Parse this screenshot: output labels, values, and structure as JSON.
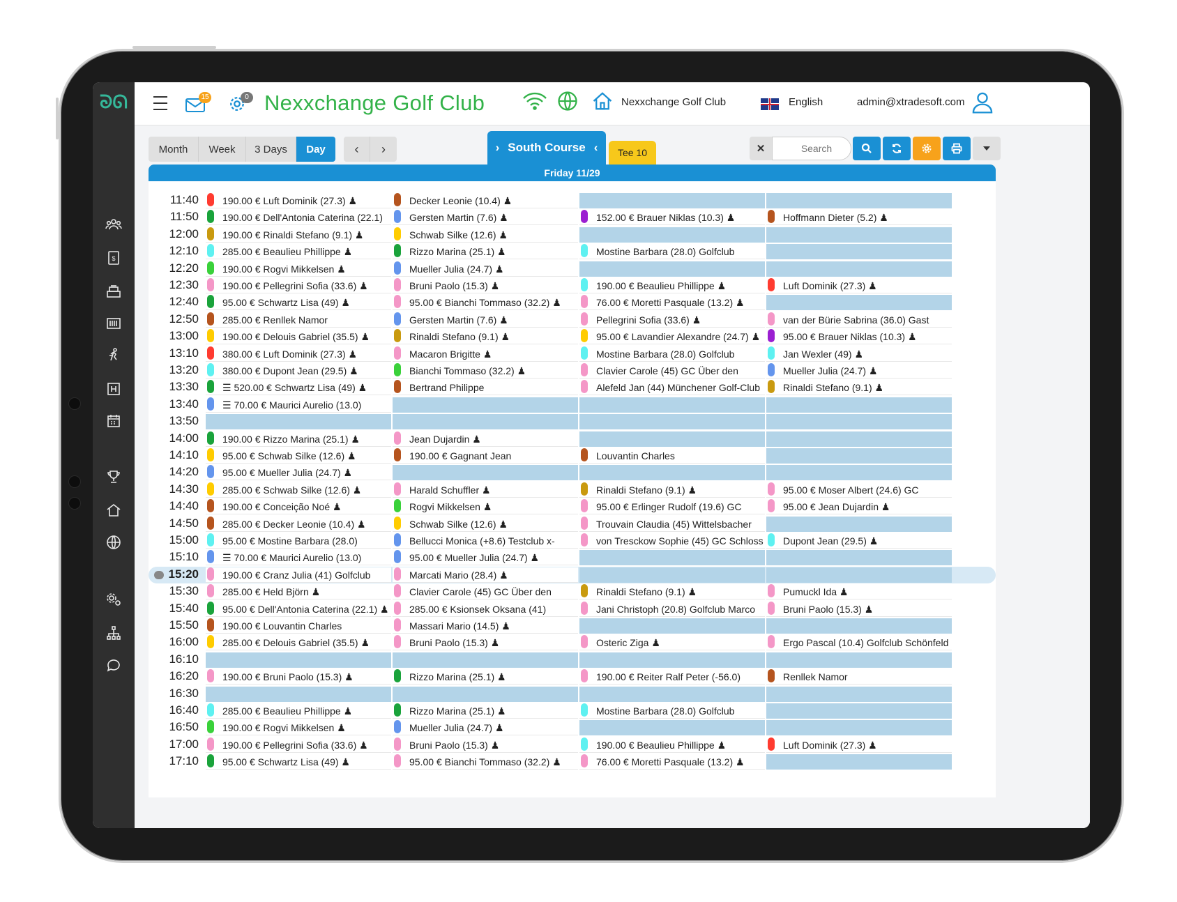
{
  "app": {
    "title": "Nexxchange Golf Club",
    "mail_count": "15",
    "settings_count": "0",
    "club": "Nexxchange Golf Club",
    "language": "English",
    "user": "admin@xtradesoft.com"
  },
  "sidebar": {
    "icons": [
      "group-icon",
      "invoice-icon",
      "register-icon",
      "barcode-icon",
      "activity-icon",
      "hotel-icon",
      "calendar-icon",
      "trophy-icon",
      "home-icon",
      "globe-icon",
      "settings-icon",
      "org-chart-icon",
      "chat-icon"
    ]
  },
  "toolbar": {
    "views": [
      "Month",
      "Week",
      "3 Days",
      "Day"
    ],
    "active_view": "Day",
    "prev": "‹",
    "next": "›",
    "course": "South Course",
    "tee": "Tee 10",
    "clear": "✕",
    "search_placeholder": "Search",
    "date": "Friday 11/29"
  },
  "colors": {
    "accent": "#1a90d4",
    "brand": "#33b249",
    "empty_slot": "#b3d4e8",
    "orange": "#f7a21b"
  },
  "tee_sheet": {
    "current_time": "15:20",
    "rows": [
      {
        "time": "11:40",
        "slots": [
          {
            "c": "#ff3b30",
            "t": "190.00 € Luft Dominik (27.3) ♟"
          },
          {
            "c": "#b5541e",
            "t": "Decker Leonie (10.4) ♟"
          },
          null,
          null
        ]
      },
      {
        "time": "11:50",
        "slots": [
          {
            "c": "#1aa33b",
            "t": "190.00 € Dell'Antonia Caterina (22.1)"
          },
          {
            "c": "#6495ed",
            "t": "Gersten Martin (7.6) ♟"
          },
          {
            "c": "#9b1fd1",
            "t": "152.00 € Brauer Niklas (10.3) ♟"
          },
          {
            "c": "#b5541e",
            "t": "Hoffmann Dieter (5.2) ♟"
          }
        ]
      },
      {
        "time": "12:00",
        "slots": [
          {
            "c": "#c99a0f",
            "t": "190.00 € Rinaldi Stefano (9.1) ♟"
          },
          {
            "c": "#ffcc00",
            "t": "Schwab Silke (12.6) ♟"
          },
          null,
          null
        ]
      },
      {
        "time": "12:10",
        "slots": [
          {
            "c": "#5ef1f1",
            "t": "285.00 € Beaulieu Phillippe ♟"
          },
          {
            "c": "#1aa33b",
            "t": "Rizzo Marina (25.1) ♟"
          },
          {
            "c": "#5ef1f1",
            "t": "Mostine Barbara (28.0) Golfclub"
          },
          null
        ]
      },
      {
        "time": "12:20",
        "slots": [
          {
            "c": "#3ad13a",
            "t": "190.00 € Rogvi Mikkelsen ♟"
          },
          {
            "c": "#6495ed",
            "t": "Mueller Julia (24.7) ♟"
          },
          null,
          null
        ]
      },
      {
        "time": "12:30",
        "slots": [
          {
            "c": "#f497c7",
            "t": "190.00 € Pellegrini Sofia (33.6) ♟"
          },
          {
            "c": "#f497c7",
            "t": "Bruni Paolo (15.3) ♟"
          },
          {
            "c": "#5ef1f1",
            "t": "190.00 € Beaulieu Phillippe ♟"
          },
          {
            "c": "#ff3b30",
            "t": "Luft Dominik (27.3) ♟"
          }
        ]
      },
      {
        "time": "12:40",
        "slots": [
          {
            "c": "#1aa33b",
            "t": "95.00 € Schwartz Lisa (49) ♟"
          },
          {
            "c": "#f497c7",
            "t": "95.00 € Bianchi Tommaso (32.2) ♟"
          },
          {
            "c": "#f497c7",
            "t": "76.00 € Moretti Pasquale (13.2) ♟"
          },
          null
        ]
      },
      {
        "time": "12:50",
        "slots": [
          {
            "c": "#b5541e",
            "t": "285.00 € Renllek Namor"
          },
          {
            "c": "#6495ed",
            "t": "Gersten Martin (7.6) ♟"
          },
          {
            "c": "#f497c7",
            "t": "Pellegrini Sofia (33.6) ♟"
          },
          {
            "c": "#f497c7",
            "t": "van der Bürie Sabrina (36.0) Gast"
          }
        ]
      },
      {
        "time": "13:00",
        "slots": [
          {
            "c": "#ffcc00",
            "t": "190.00 € Delouis Gabriel (35.5) ♟"
          },
          {
            "c": "#c99a0f",
            "t": "Rinaldi Stefano (9.1) ♟"
          },
          {
            "c": "#ffcc00",
            "t": "95.00 € Lavandier Alexandre (24.7) ♟"
          },
          {
            "c": "#9b1fd1",
            "t": "95.00 € Brauer Niklas (10.3) ♟"
          }
        ]
      },
      {
        "time": "13:10",
        "slots": [
          {
            "c": "#ff3b30",
            "t": "380.00 € Luft Dominik (27.3) ♟"
          },
          {
            "c": "#f497c7",
            "t": "Macaron Brigitte ♟"
          },
          {
            "c": "#5ef1f1",
            "t": "Mostine Barbara (28.0) Golfclub"
          },
          {
            "c": "#5ef1f1",
            "t": "Jan Wexler (49) ♟"
          }
        ]
      },
      {
        "time": "13:20",
        "slots": [
          {
            "c": "#5ef1f1",
            "t": "380.00 € Dupont Jean (29.5) ♟"
          },
          {
            "c": "#3ad13a",
            "t": "Bianchi Tommaso (32.2) ♟"
          },
          {
            "c": "#f497c7",
            "t": "Clavier Carole (45) GC Über den"
          },
          {
            "c": "#6495ed",
            "t": "Mueller Julia (24.7) ♟"
          }
        ]
      },
      {
        "time": "13:30",
        "slots": [
          {
            "c": "#1aa33b",
            "t": "☰ 520.00 € Schwartz Lisa (49) ♟"
          },
          {
            "c": "#b5541e",
            "t": "Bertrand Philippe"
          },
          {
            "c": "#f497c7",
            "t": "Alefeld Jan (44) Münchener Golf-Club"
          },
          {
            "c": "#c99a0f",
            "t": "Rinaldi Stefano (9.1) ♟"
          }
        ]
      },
      {
        "time": "13:40",
        "slots": [
          {
            "c": "#6495ed",
            "t": "☰ 70.00 € Maurici Aurelio (13.0)"
          },
          null,
          null,
          null
        ]
      },
      {
        "time": "13:50",
        "slots": [
          null,
          null,
          null,
          null
        ]
      },
      {
        "time": "14:00",
        "slots": [
          {
            "c": "#1aa33b",
            "t": "190.00 € Rizzo Marina (25.1) ♟"
          },
          {
            "c": "#f497c7",
            "t": "Jean Dujardin ♟"
          },
          null,
          null
        ]
      },
      {
        "time": "14:10",
        "slots": [
          {
            "c": "#ffcc00",
            "t": "95.00 € Schwab Silke (12.6) ♟"
          },
          {
            "c": "#b5541e",
            "t": "190.00 € Gagnant Jean"
          },
          {
            "c": "#b5541e",
            "t": "Louvantin Charles"
          },
          null
        ]
      },
      {
        "time": "14:20",
        "slots": [
          {
            "c": "#6495ed",
            "t": "95.00 € Mueller Julia (24.7) ♟"
          },
          null,
          null,
          null
        ]
      },
      {
        "time": "14:30",
        "slots": [
          {
            "c": "#ffcc00",
            "t": "285.00 € Schwab Silke (12.6) ♟"
          },
          {
            "c": "#f497c7",
            "t": "Harald Schuffler ♟"
          },
          {
            "c": "#c99a0f",
            "t": "Rinaldi Stefano (9.1) ♟"
          },
          {
            "c": "#f497c7",
            "t": "95.00 € Moser Albert (24.6) GC"
          }
        ]
      },
      {
        "time": "14:40",
        "slots": [
          {
            "c": "#b5541e",
            "t": "190.00 € Conceição Noé ♟"
          },
          {
            "c": "#3ad13a",
            "t": "Rogvi Mikkelsen ♟"
          },
          {
            "c": "#f497c7",
            "t": "95.00 € Erlinger Rudolf (19.6) GC"
          },
          {
            "c": "#f497c7",
            "t": "95.00 € Jean Dujardin ♟"
          }
        ]
      },
      {
        "time": "14:50",
        "slots": [
          {
            "c": "#b5541e",
            "t": "285.00 € Decker Leonie (10.4) ♟"
          },
          {
            "c": "#ffcc00",
            "t": "Schwab Silke (12.6) ♟"
          },
          {
            "c": "#f497c7",
            "t": "Trouvain Claudia (45) Wittelsbacher"
          },
          null
        ]
      },
      {
        "time": "15:00",
        "slots": [
          {
            "c": "#5ef1f1",
            "t": "95.00 € Mostine Barbara (28.0)"
          },
          {
            "c": "#6495ed",
            "t": "Bellucci Monica (+8.6) Testclub x-"
          },
          {
            "c": "#f497c7",
            "t": "von Tresckow Sophie (45) GC Schloss"
          },
          {
            "c": "#5ef1f1",
            "t": "Dupont Jean (29.5) ♟"
          }
        ]
      },
      {
        "time": "15:10",
        "slots": [
          {
            "c": "#6495ed",
            "t": "☰ 70.00 € Maurici Aurelio (13.0)"
          },
          {
            "c": "#6495ed",
            "t": "95.00 € Mueller Julia (24.7) ♟"
          },
          null,
          null
        ]
      },
      {
        "time": "15:20",
        "slots": [
          {
            "c": "#f497c7",
            "t": "190.00 € Cranz Julia (41) Golfclub"
          },
          {
            "c": "#f497c7",
            "t": "Marcati Mario (28.4) ♟"
          },
          null,
          null
        ]
      },
      {
        "time": "15:30",
        "slots": [
          {
            "c": "#f497c7",
            "t": "285.00 € Held Björn ♟"
          },
          {
            "c": "#f497c7",
            "t": "Clavier Carole (45) GC Über den"
          },
          {
            "c": "#c99a0f",
            "t": "Rinaldi Stefano (9.1) ♟"
          },
          {
            "c": "#f497c7",
            "t": "Pumuckl Ida ♟"
          }
        ]
      },
      {
        "time": "15:40",
        "slots": [
          {
            "c": "#1aa33b",
            "t": "95.00 € Dell'Antonia Caterina (22.1) ♟"
          },
          {
            "c": "#f497c7",
            "t": "285.00 € Ksionsek Oksana (41)"
          },
          {
            "c": "#f497c7",
            "t": "Jani Christoph (20.8) Golfclub Marco"
          },
          {
            "c": "#f497c7",
            "t": "Bruni Paolo (15.3) ♟"
          }
        ]
      },
      {
        "time": "15:50",
        "slots": [
          {
            "c": "#b5541e",
            "t": "190.00 € Louvantin Charles"
          },
          {
            "c": "#f497c7",
            "t": "Massari Mario (14.5) ♟"
          },
          null,
          null
        ]
      },
      {
        "time": "16:00",
        "slots": [
          {
            "c": "#ffcc00",
            "t": "285.00 € Delouis Gabriel (35.5) ♟"
          },
          {
            "c": "#f497c7",
            "t": "Bruni Paolo (15.3) ♟"
          },
          {
            "c": "#f497c7",
            "t": "Osteric Ziga ♟"
          },
          {
            "c": "#f497c7",
            "t": "Ergo Pascal (10.4) Golfclub Schönfeld"
          }
        ]
      },
      {
        "time": "16:10",
        "slots": [
          null,
          null,
          null,
          null
        ]
      },
      {
        "time": "16:20",
        "slots": [
          {
            "c": "#f497c7",
            "t": "190.00 € Bruni Paolo (15.3) ♟"
          },
          {
            "c": "#1aa33b",
            "t": "Rizzo Marina (25.1) ♟"
          },
          {
            "c": "#f497c7",
            "t": "190.00 € Reiter Ralf Peter (-56.0)"
          },
          {
            "c": "#b5541e",
            "t": "Renllek Namor"
          }
        ]
      },
      {
        "time": "16:30",
        "slots": [
          null,
          null,
          null,
          null
        ]
      },
      {
        "time": "16:40",
        "slots": [
          {
            "c": "#5ef1f1",
            "t": "285.00 € Beaulieu Phillippe ♟"
          },
          {
            "c": "#1aa33b",
            "t": "Rizzo Marina (25.1) ♟"
          },
          {
            "c": "#5ef1f1",
            "t": "Mostine Barbara (28.0) Golfclub"
          },
          null
        ]
      },
      {
        "time": "16:50",
        "slots": [
          {
            "c": "#3ad13a",
            "t": "190.00 € Rogvi Mikkelsen ♟"
          },
          {
            "c": "#6495ed",
            "t": "Mueller Julia (24.7) ♟"
          },
          null,
          null
        ]
      },
      {
        "time": "17:00",
        "slots": [
          {
            "c": "#f497c7",
            "t": "190.00 € Pellegrini Sofia (33.6) ♟"
          },
          {
            "c": "#f497c7",
            "t": "Bruni Paolo (15.3) ♟"
          },
          {
            "c": "#5ef1f1",
            "t": "190.00 € Beaulieu Phillippe ♟"
          },
          {
            "c": "#ff3b30",
            "t": "Luft Dominik (27.3) ♟"
          }
        ]
      },
      {
        "time": "17:10",
        "slots": [
          {
            "c": "#1aa33b",
            "t": "95.00 € Schwartz Lisa (49) ♟"
          },
          {
            "c": "#f497c7",
            "t": "95.00 € Bianchi Tommaso (32.2) ♟"
          },
          {
            "c": "#f497c7",
            "t": "76.00 € Moretti Pasquale (13.2) ♟"
          },
          null
        ]
      }
    ]
  }
}
